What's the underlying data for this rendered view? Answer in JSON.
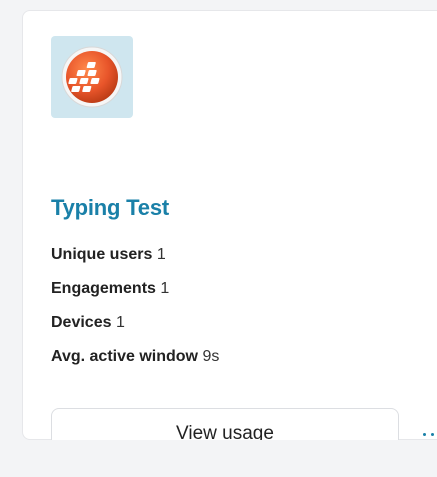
{
  "app": {
    "name": "Typing Test",
    "icon": "typing-test-app-icon",
    "accent_color": "#1a80a8",
    "icon_color": "#e8552a"
  },
  "stats": [
    {
      "label": "Unique users",
      "value": "1"
    },
    {
      "label": "Engagements",
      "value": "1"
    },
    {
      "label": "Devices",
      "value": "1"
    },
    {
      "label": "Avg. active window",
      "value": "9s"
    }
  ],
  "actions": {
    "view_usage_label": "View usage",
    "more_icon": "more-options-icon"
  }
}
